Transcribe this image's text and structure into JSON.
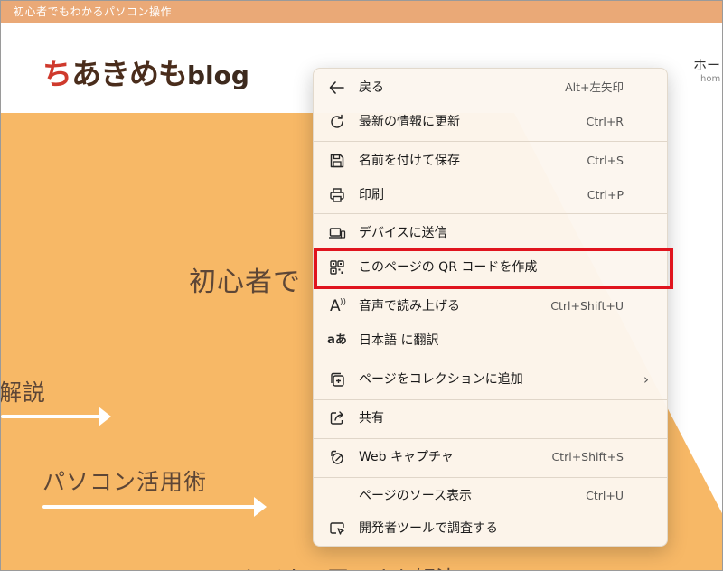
{
  "banner": {
    "title": "初心者でもわかるパソコン操作"
  },
  "logo": {
    "first_char": "ち",
    "rest": "あきめも",
    "suffix": "blog"
  },
  "nav": {
    "item": "ホー",
    "sub": "hom"
  },
  "hero": {
    "title": "初心者で",
    "left_label": "解説",
    "label_2": "パソコン活用術",
    "bottom_partial": "トイカン田ーオキ解決"
  },
  "context_menu": {
    "items": [
      {
        "label": "戻る",
        "shortcut": "Alt+左矢印",
        "icon": "back-arrow-icon"
      },
      {
        "label": "最新の情報に更新",
        "shortcut": "Ctrl+R",
        "icon": "refresh-icon"
      },
      {
        "label": "名前を付けて保存",
        "shortcut": "Ctrl+S",
        "icon": "save-icon"
      },
      {
        "label": "印刷",
        "shortcut": "Ctrl+P",
        "icon": "printer-icon"
      },
      {
        "label": "デバイスに送信",
        "shortcut": "",
        "icon": "device-icon"
      },
      {
        "label": "このページの QR コードを作成",
        "shortcut": "",
        "icon": "qr-code-icon"
      },
      {
        "label": "音声で読み上げる",
        "shortcut": "Ctrl+Shift+U",
        "icon": "read-aloud-icon"
      },
      {
        "label": "日本語 に翻訳",
        "shortcut": "",
        "icon": "translate-icon"
      },
      {
        "label": "ページをコレクションに追加",
        "shortcut": "",
        "icon": "collections-icon"
      },
      {
        "label": "共有",
        "shortcut": "",
        "icon": "share-icon"
      },
      {
        "label": "Web キャプチャ",
        "shortcut": "Ctrl+Shift+S",
        "icon": "web-capture-icon"
      },
      {
        "label": "ページのソース表示",
        "shortcut": "Ctrl+U",
        "icon": ""
      },
      {
        "label": "開発者ツールで調査する",
        "shortcut": "",
        "icon": "devtools-icon"
      }
    ],
    "read_aloud_glyph": "A",
    "translate_glyph": "aあ",
    "submenu_chevron": "›"
  },
  "colors": {
    "banner": "#eaa977",
    "hero": "#f7b866",
    "highlight": "#e0141e",
    "logo_red": "#cf3a2d",
    "logo_brown": "#4a2d1c"
  }
}
